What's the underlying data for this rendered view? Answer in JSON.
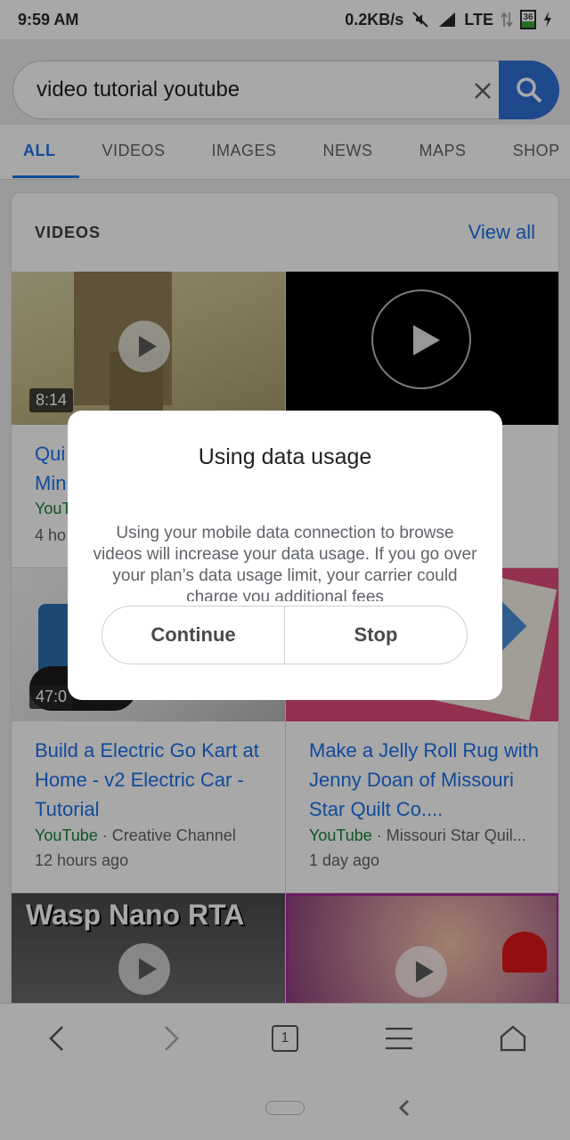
{
  "status_bar": {
    "time": "9:59 AM",
    "net_speed": "0.2KB/s",
    "network": "LTE",
    "battery": "36"
  },
  "search": {
    "query": "video tutorial youtube"
  },
  "tabs": [
    "ALL",
    "VIDEOS",
    "IMAGES",
    "NEWS",
    "MAPS",
    "SHOP"
  ],
  "videos_section": {
    "title": "VIDEOS",
    "view_all": "View all",
    "items": [
      {
        "duration": "8:14",
        "title": "Qui",
        "title2": "Min",
        "source": "YouT",
        "time": "4 ho"
      },
      {
        "duration": "",
        "title": "",
        "source": "",
        "time": ""
      },
      {
        "duration": "47:0",
        "title": "Build a Electric Go Kart at Home - v2 Electric Car - Tutorial",
        "source_site": "YouTube",
        "source_channel": "Creative Channel",
        "time": "12 hours ago"
      },
      {
        "duration": "",
        "title": "Make a Jelly Roll Rug with Jenny Doan of Missouri Star Quilt Co....",
        "source_site": "YouTube",
        "source_channel": "Missouri Star Quil...",
        "time": "1 day ago"
      },
      {
        "thumb_text": "Wasp Nano RTA"
      }
    ]
  },
  "dialog": {
    "title": "Using data usage",
    "body": "Using your mobile data connection to browse videos will increase your data usage. If you go over your plan’s data usage limit, your carrier could charge you additional fees",
    "continue": "Continue",
    "stop": "Stop"
  },
  "bottom_nav": {
    "tab_count": "1"
  },
  "colors": {
    "accent": "#1a73e8",
    "search_button": "#2f6fd6",
    "source_green": "#188038"
  }
}
